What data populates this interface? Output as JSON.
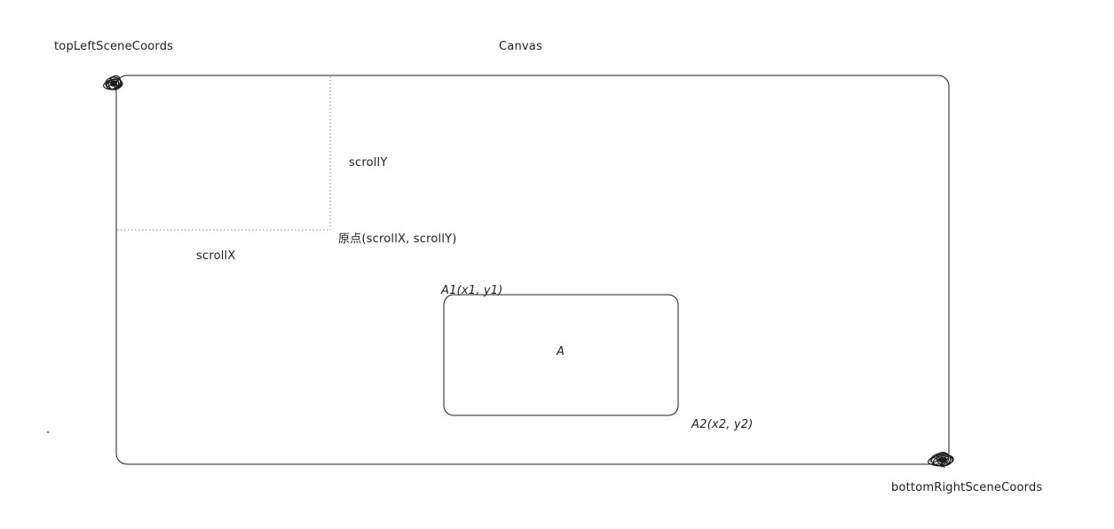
{
  "labels": {
    "top_left": "topLeftSceneCoords",
    "canvas": "Canvas",
    "scroll_y": "scrollY",
    "origin": "原点(scrollX, scrollY)",
    "scroll_x": "scrollX",
    "a1": "A1(x1, y1)",
    "a": "A",
    "a2": "A2(x2, y2)",
    "bottom_right": "bottomRightSceneCoords"
  },
  "colors": {
    "stroke": "#1e1e1e",
    "dotted": "#8a8a8a",
    "background": "#ffffff"
  }
}
